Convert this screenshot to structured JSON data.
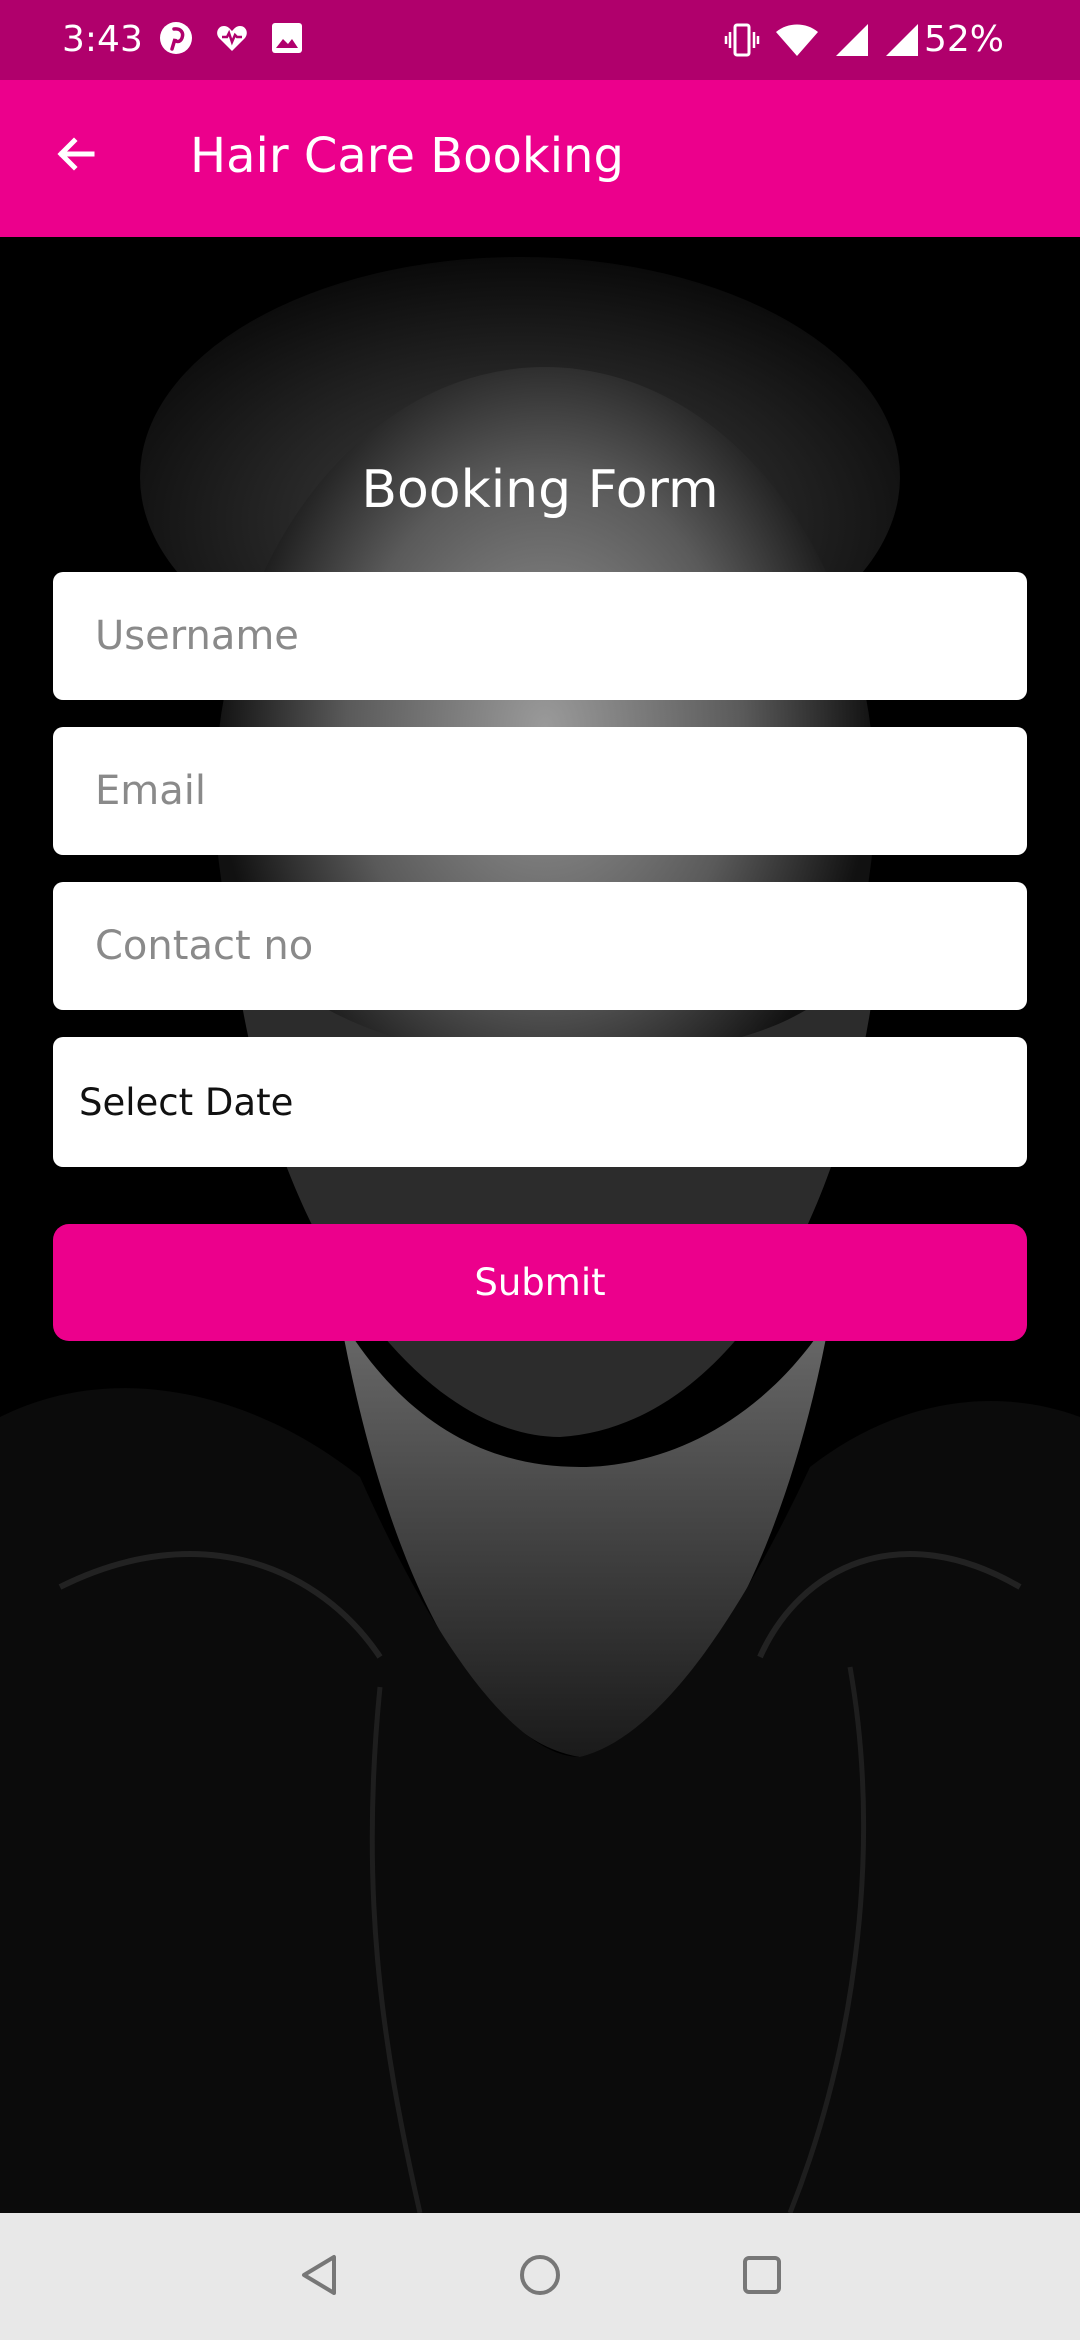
{
  "status_bar": {
    "time": "3:43",
    "battery": "52%",
    "left_icons": [
      "pinterest-icon",
      "health-icon",
      "image-icon"
    ],
    "right_icons": [
      "vibrate-icon",
      "wifi-icon",
      "signal-icon",
      "signal-icon"
    ]
  },
  "app_bar": {
    "title": "Hair Care Booking",
    "back_icon": "arrow-back-icon"
  },
  "form": {
    "title": "Booking Form",
    "username_placeholder": "Username",
    "email_placeholder": "Email",
    "contact_placeholder": "Contact no",
    "date_label": "Select Date",
    "submit_label": "Submit"
  },
  "nav_bar": {
    "icons": [
      "nav-back-icon",
      "nav-home-icon",
      "nav-recents-icon"
    ]
  },
  "colors": {
    "accent": "#ec008c",
    "status_bar": "#b0006c",
    "nav_bar": "#e8e8e8"
  }
}
